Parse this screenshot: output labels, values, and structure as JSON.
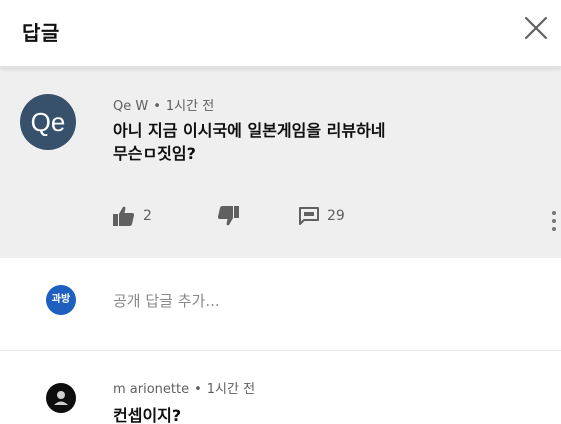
{
  "header": {
    "title": "답글",
    "close_icon": "close-icon"
  },
  "parent_comment": {
    "avatar_text": "Qe",
    "avatar_color": "#37506b",
    "author": "Qe W",
    "separator": "•",
    "time": "1시간 전",
    "text_line1": "아니 지금 이시국에 일본게임을 리뷰하네",
    "text_line2": "무슨ㅁ짓임?",
    "like_count": "2",
    "reply_count": "29",
    "icons": [
      "thumbs-up-icon",
      "thumbs-down-icon",
      "comment-icon",
      "more-vert-icon"
    ]
  },
  "add_reply": {
    "avatar_text": "과방",
    "avatar_color": "#1f5fbf",
    "placeholder": "공개 답글 추가..."
  },
  "replies": [
    {
      "author": "m arionette",
      "separator": "•",
      "time": "1시간 전",
      "text": "컨셉이지?",
      "avatar_color": "#0d0d0d"
    }
  ]
}
